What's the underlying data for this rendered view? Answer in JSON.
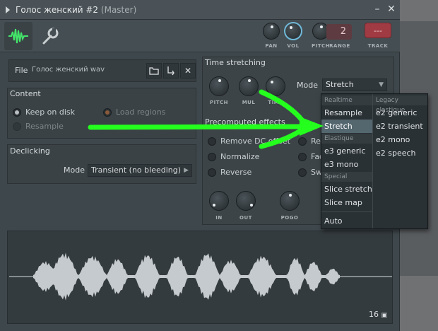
{
  "window": {
    "title": "Голос женский #2",
    "title_suffix": "(Master)",
    "minimize": "–",
    "close": "✕"
  },
  "toolbar": {
    "knobs": {
      "pan": "PAN",
      "vol": "VOL",
      "pitch": "PITCH",
      "range": "RANGE",
      "track": "TRACK"
    },
    "range_value": "2",
    "track_value": "---"
  },
  "file": {
    "label": "File",
    "name": "Голос женский wav"
  },
  "content": {
    "title": "Content",
    "keep_on_disk": "Keep on disk",
    "load_regions": "Load regions",
    "resample": "Resample"
  },
  "declicking": {
    "title": "Declicking",
    "mode_label": "Mode",
    "mode_value": "Transient (no bleeding)"
  },
  "time_stretching": {
    "title": "Time stretching",
    "knobs": {
      "pitch": "PITCH",
      "mul": "MUL",
      "time": "TIME"
    },
    "mode_label": "Mode",
    "mode_value": "Stretch"
  },
  "precomputed": {
    "title": "Precomputed effects",
    "remove_dc": "Remove DC offset",
    "normalize": "Normalize",
    "reverse": "Reverse",
    "rev_partial": "Rev",
    "fad_partial": "Fad",
    "swa_partial": "Swa",
    "knobs": {
      "in": "IN",
      "out": "OUT",
      "pogo": "POGO"
    }
  },
  "dropdown": {
    "col1_header": "Realtime",
    "resample": "Resample",
    "stretch": "Stretch",
    "elastique_header": "Elastique",
    "e3_generic": "e3 generic",
    "e3_mono": "e3 mono",
    "special_header": "Special",
    "slice_stretch": "Slice stretch",
    "slice_map": "Slice map",
    "auto": "Auto",
    "col2_header": "Legacy elastique",
    "e2_generic": "e2 generic",
    "e2_transient": "e2 transient",
    "e2_mono": "e2 mono",
    "e2_speech": "e2 speech"
  },
  "waveform": {
    "counter": "16"
  },
  "colors": {
    "accent_green": "#24ff1e",
    "track_red": "#a13b43",
    "selected_item": "#54676f"
  }
}
